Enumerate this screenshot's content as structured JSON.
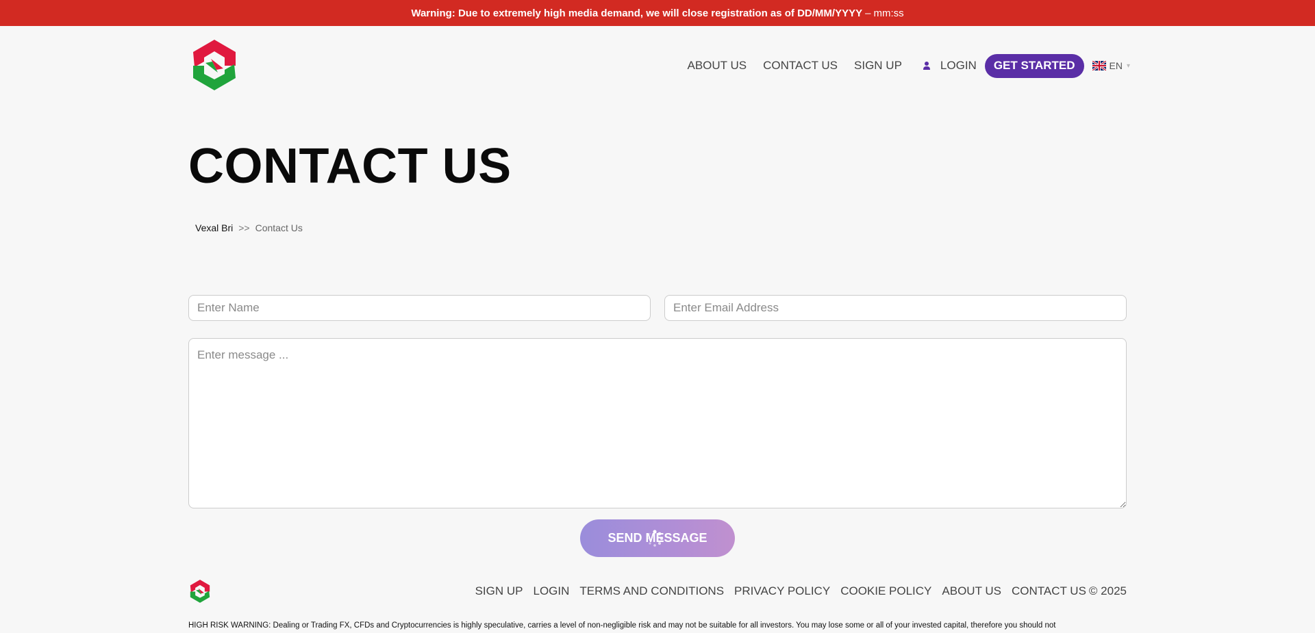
{
  "warning": {
    "bold": "Warning: Due to extremely high media demand, we will close registration as of DD/MM/YYYY",
    "sep": "–",
    "timer": "mm:ss"
  },
  "brand": {
    "colors": {
      "red": "#e0193f",
      "green": "#20a43c",
      "purple": "#5a2ea6",
      "warning": "#d22a22"
    }
  },
  "nav": {
    "about": "ABOUT US",
    "contact": "CONTACT US",
    "signup": "SIGN UP",
    "login": "LOGIN",
    "get_started": "GET STARTED",
    "language": "EN"
  },
  "page": {
    "title": "CONTACT US",
    "breadcrumb": {
      "home": "Vexal Bri",
      "separator": ">>",
      "current": "Contact Us"
    }
  },
  "form": {
    "name_placeholder": "Enter Name",
    "email_placeholder": "Enter Email Address",
    "message_placeholder": "Enter message ...",
    "send_label": "SEND MESSAGE"
  },
  "footer": {
    "links": [
      "SIGN UP",
      "LOGIN",
      "TERMS AND CONDITIONS",
      "PRIVACY POLICY",
      "COOKIE POLICY",
      "ABOUT US",
      "CONTACT US"
    ],
    "copyright": "© 2025",
    "risk_warning": "HIGH RISK WARNING: Dealing or Trading FX, CFDs and Cryptocurrencies is highly speculative, carries a level of non-negligible risk and may not be suitable for all investors. You may lose some or all of your invested capital, therefore you should not"
  },
  "icons": [
    "logo-icon",
    "user-icon",
    "uk-flag-icon",
    "loading-spinner-icon",
    "footer-logo-icon"
  ]
}
